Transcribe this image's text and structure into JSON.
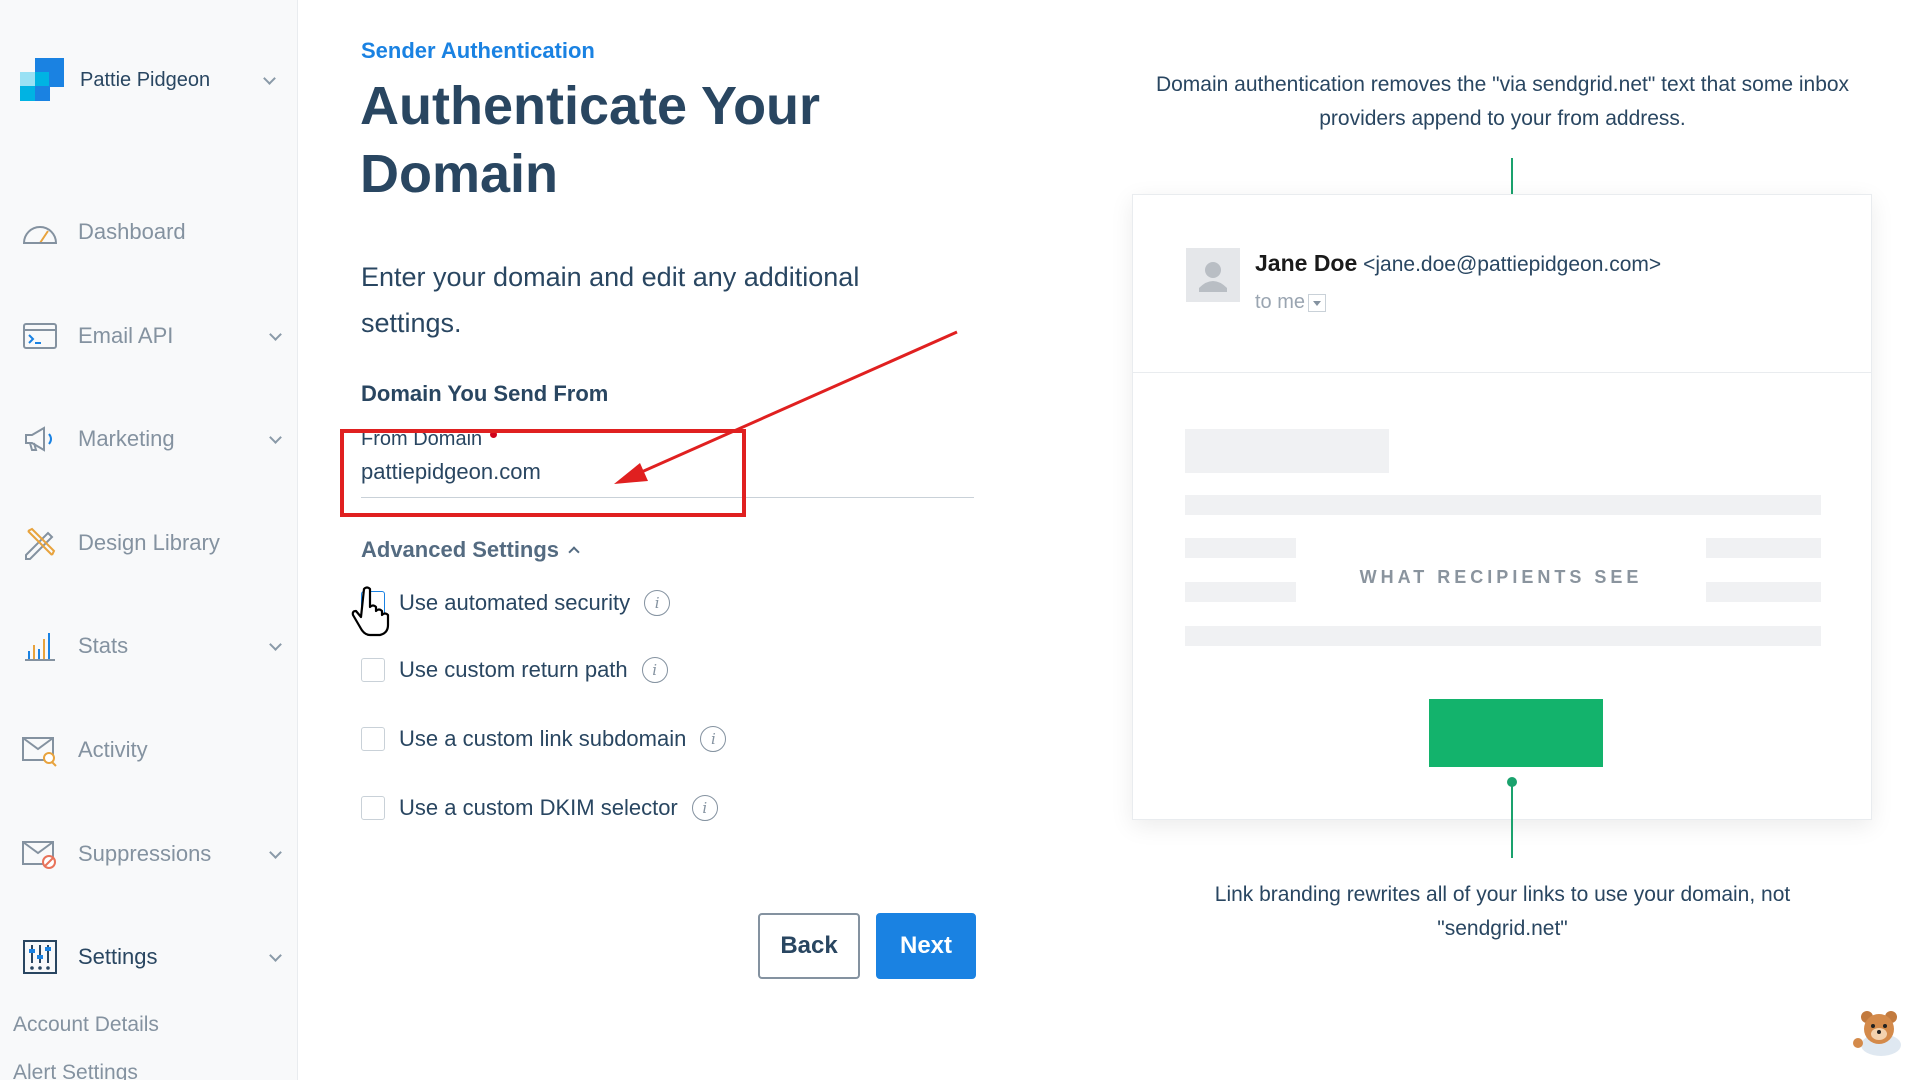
{
  "account": {
    "name": "Pattie Pidgeon",
    "logo_icon": "sendgrid-logo"
  },
  "sidebar": {
    "items": [
      {
        "label": "Dashboard",
        "icon": "gauge-icon",
        "has_menu": false
      },
      {
        "label": "Email API",
        "icon": "terminal-window-icon",
        "has_menu": true
      },
      {
        "label": "Marketing",
        "icon": "megaphone-icon",
        "has_menu": true
      },
      {
        "label": "Design Library",
        "icon": "pencil-ruler-icon",
        "has_menu": false
      },
      {
        "label": "Stats",
        "icon": "bar-chart-icon",
        "has_menu": true
      },
      {
        "label": "Activity",
        "icon": "envelope-search-icon",
        "has_menu": false
      },
      {
        "label": "Suppressions",
        "icon": "envelope-blocked-icon",
        "has_menu": true
      },
      {
        "label": "Settings",
        "icon": "sliders-icon",
        "has_menu": true
      }
    ],
    "sub_items": [
      "Account Details",
      "Alert Settings"
    ]
  },
  "main": {
    "eyebrow": "Sender Authentication",
    "title": "Authenticate Your Domain",
    "intro": "Enter your domain and edit any additional settings.",
    "section_label": "Domain You Send From",
    "from_domain": {
      "label": "From Domain",
      "value": "pattiepidgeon.com",
      "required": true
    },
    "advanced_label": "Advanced Settings",
    "options": [
      {
        "label": "Use automated security",
        "checked": false
      },
      {
        "label": "Use custom return path",
        "checked": false
      },
      {
        "label": "Use a custom link subdomain",
        "checked": false
      },
      {
        "label": "Use a custom DKIM selector",
        "checked": false
      }
    ],
    "back_label": "Back",
    "next_label": "Next"
  },
  "preview": {
    "top_note": "Domain authentication removes the \"via sendgrid.net\" text that some inbox providers append to your from address.",
    "sender_name": "Jane Doe",
    "sender_email": "<jane.doe@pattiepidgeon.com>",
    "to_text": "to me",
    "placeholder_label": "WHAT RECIPIENTS SEE",
    "bottom_note": "Link branding rewrites all of your links to use your domain, not \"sendgrid.net\""
  },
  "colors": {
    "accent": "#1a82e2",
    "navy": "#294661",
    "green": "#13b36c",
    "highlight": "#e02020"
  }
}
